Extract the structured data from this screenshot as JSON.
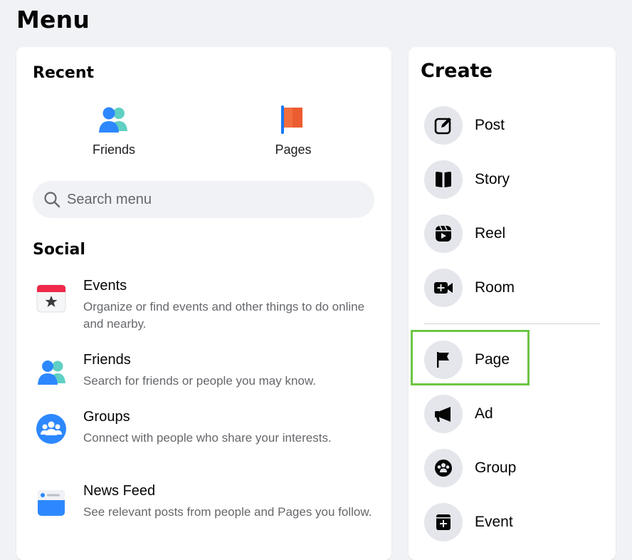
{
  "page_title": "Menu",
  "recent": {
    "title": "Recent",
    "items": [
      {
        "label": "Friends",
        "icon": "friends-icon"
      },
      {
        "label": "Pages",
        "icon": "pages-flag-icon"
      }
    ]
  },
  "search": {
    "placeholder": "Search menu",
    "icon": "search-icon"
  },
  "social": {
    "title": "Social",
    "items": [
      {
        "title": "Events",
        "description": "Organize or find events and other things to do online and nearby.",
        "icon": "events-calendar-icon"
      },
      {
        "title": "Friends",
        "description": "Search for friends or people you may know.",
        "icon": "friends-icon"
      },
      {
        "title": "Groups",
        "description": "Connect with people who share your interests.",
        "icon": "groups-icon"
      },
      {
        "title": "News Feed",
        "description": "See relevant posts from people and Pages you follow.",
        "icon": "news-feed-icon"
      }
    ]
  },
  "create": {
    "title": "Create",
    "items": [
      {
        "label": "Post",
        "icon": "edit-post-icon"
      },
      {
        "label": "Story",
        "icon": "story-book-icon"
      },
      {
        "label": "Reel",
        "icon": "reel-icon"
      },
      {
        "label": "Room",
        "icon": "video-room-icon"
      },
      {
        "label": "Page",
        "icon": "flag-icon",
        "highlighted": true
      },
      {
        "label": "Ad",
        "icon": "megaphone-icon"
      },
      {
        "label": "Group",
        "icon": "group-icon"
      },
      {
        "label": "Event",
        "icon": "event-calendar-plus-icon"
      }
    ]
  },
  "colors": {
    "background": "#f0f2f5",
    "card": "#ffffff",
    "icon_circle": "#e4e6eb",
    "highlight_border": "#6cc644",
    "secondary_text": "#65676b",
    "facebook_blue": "#1877f2"
  }
}
